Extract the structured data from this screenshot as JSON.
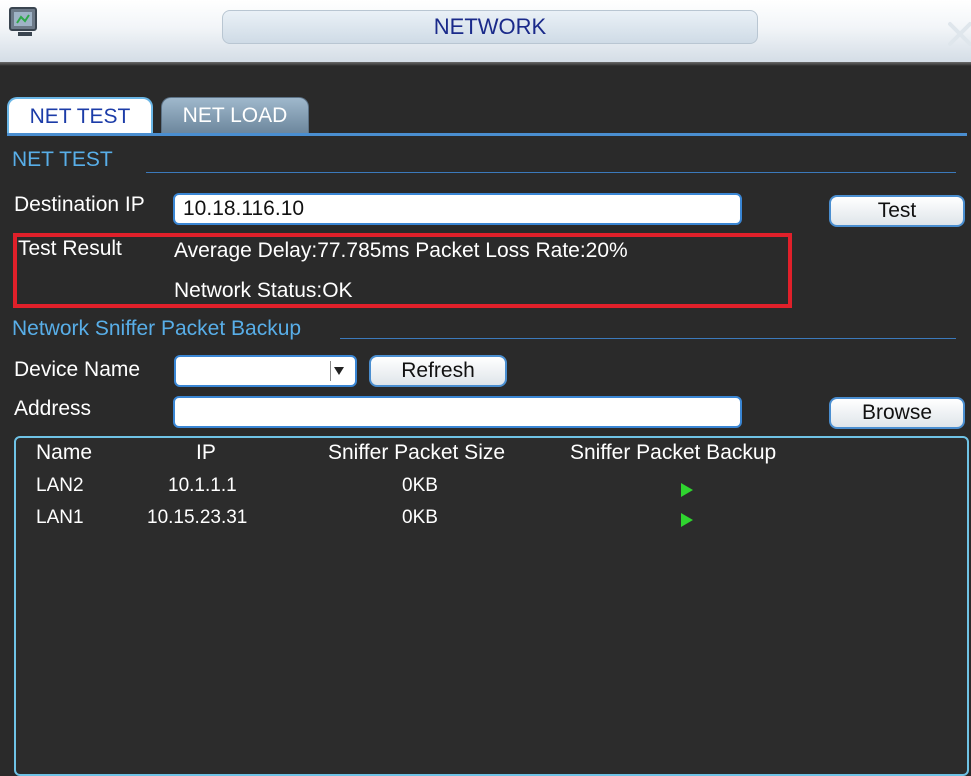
{
  "window": {
    "title": "NETWORK",
    "icons": {
      "app": "monitor-icon",
      "close": "close-icon"
    }
  },
  "tabs": [
    {
      "label": "NET TEST",
      "active": true
    },
    {
      "label": "NET LOAD",
      "active": false
    }
  ],
  "net_test": {
    "section_title": "NET TEST",
    "destination_ip_label": "Destination IP",
    "destination_ip_value": "10.18.116.10",
    "test_button": "Test",
    "test_result_label": "Test Result",
    "result_line1": "Average Delay:77.785ms  Packet Loss Rate:20%",
    "result_line2": "Network Status:OK",
    "highlight_color": "#e0202a"
  },
  "sniffer": {
    "section_title": "Network Sniffer Packet Backup",
    "device_name_label": "Device Name",
    "device_name_value": "",
    "refresh_button": "Refresh",
    "address_label": "Address",
    "address_value": "",
    "browse_button": "Browse",
    "table": {
      "columns": [
        "Name",
        "IP",
        "Sniffer Packet Size",
        "Sniffer Packet Backup"
      ],
      "rows": [
        {
          "name": "LAN2",
          "ip": "10.1.1.1",
          "size": "0KB",
          "backup_icon": "play-icon"
        },
        {
          "name": "LAN1",
          "ip": "10.15.23.31",
          "size": "0KB",
          "backup_icon": "play-icon"
        }
      ]
    }
  },
  "colors": {
    "accent": "#58aee8",
    "tab_text": "#1c3ca8",
    "background": "#2a2a2a",
    "play": "#2fd52f"
  }
}
